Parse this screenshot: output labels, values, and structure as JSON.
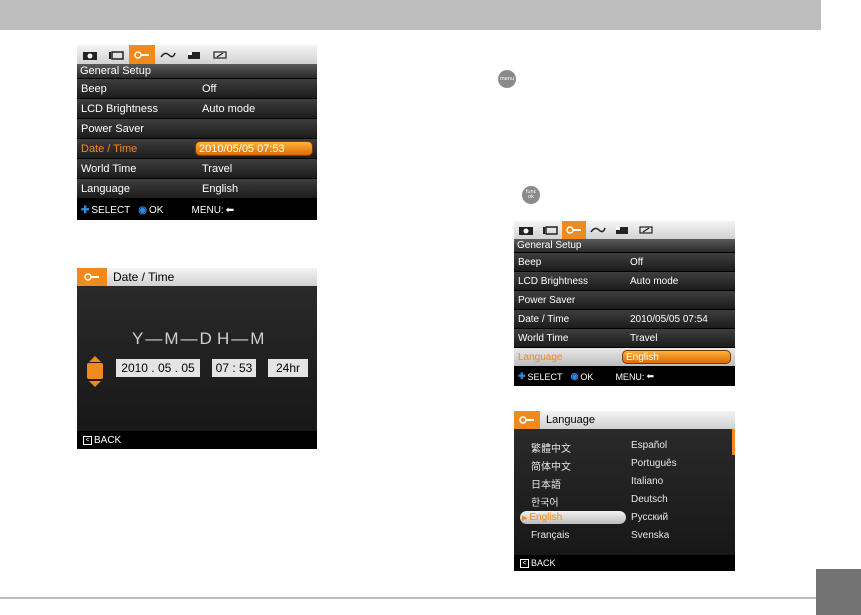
{
  "menu_screen": {
    "header": "General Setup",
    "rows": [
      {
        "label": "Beep",
        "value": "Off"
      },
      {
        "label": "LCD Brightness",
        "value": "Auto mode"
      },
      {
        "label": "Power Saver",
        "value": ""
      },
      {
        "label": "Date / Time",
        "value": "2010/05/05 07:53"
      },
      {
        "label": "World Time",
        "value": "Travel"
      },
      {
        "label": "Language",
        "value": "English"
      }
    ],
    "footer": {
      "select": "SELECT",
      "ok": "OK",
      "menu": "MENU:"
    }
  },
  "menu_screen2": {
    "header": "General Setup",
    "rows": [
      {
        "label": "Beep",
        "value": "Off"
      },
      {
        "label": "LCD Brightness",
        "value": "Auto mode"
      },
      {
        "label": "Power Saver",
        "value": ""
      },
      {
        "label": "Date / Time",
        "value": "2010/05/05 07:54"
      },
      {
        "label": "World Time",
        "value": "Travel"
      },
      {
        "label": "Language",
        "value": "English"
      }
    ],
    "footer": {
      "select": "SELECT",
      "ok": "OK",
      "menu": "MENU:"
    }
  },
  "datetime_screen": {
    "title": "Date / Time",
    "ymd_label": "Y—M—D",
    "hm_label": "H—M",
    "year": "2010",
    "month": "05",
    "day": "05",
    "time": "07 : 53",
    "format": "24hr",
    "back": "BACK"
  },
  "language_screen": {
    "title": "Language",
    "left": [
      "繁體中文",
      "简体中文",
      "日本語",
      "한국어",
      "English",
      "Français"
    ],
    "right": [
      "Español",
      "Português",
      "Italiano",
      "Deutsch",
      "Русский",
      "Svenska"
    ],
    "selected": "English",
    "back": "BACK"
  },
  "buttons": {
    "menu": "menu",
    "func": "func ok"
  },
  "colors": {
    "accent": "#f08a1c",
    "select_blue": "#2d8ae6",
    "bar_gray": "#bdbdbd"
  }
}
